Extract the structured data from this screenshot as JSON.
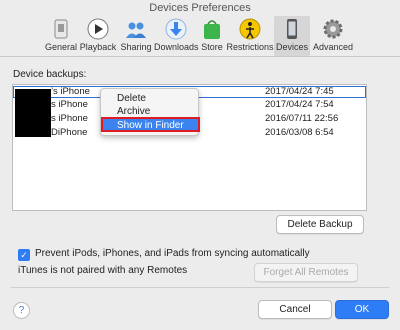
{
  "window": {
    "title": "Devices Preferences"
  },
  "toolbar": {
    "items": [
      {
        "label": "General",
        "icon": "general-icon"
      },
      {
        "label": "Playback",
        "icon": "playback-icon"
      },
      {
        "label": "Sharing",
        "icon": "sharing-icon"
      },
      {
        "label": "Downloads",
        "icon": "downloads-icon"
      },
      {
        "label": "Store",
        "icon": "store-icon"
      },
      {
        "label": "Restrictions",
        "icon": "restrictions-icon"
      },
      {
        "label": "Devices",
        "icon": "devices-icon",
        "active": true
      },
      {
        "label": "Advanced",
        "icon": "advanced-icon"
      }
    ]
  },
  "backups": {
    "label": "Device backups:",
    "rows": [
      {
        "name": "’s iPhone",
        "date": "2017/04/24 7:45",
        "selected": true
      },
      {
        "name": "s iPhone",
        "date": "2017/04/24 7:54"
      },
      {
        "name": "s iPhone",
        "date": "2016/07/11 22:56"
      },
      {
        "name": "DiPhone",
        "date": "2016/03/08 6:54"
      }
    ]
  },
  "context_menu": {
    "items": [
      {
        "label": "Delete"
      },
      {
        "label": "Archive"
      },
      {
        "label": "Show in Finder",
        "highlighted": true
      }
    ]
  },
  "buttons": {
    "delete_backup": "Delete Backup",
    "forget_remotes": "Forget All Remotes",
    "cancel": "Cancel",
    "ok": "OK"
  },
  "options": {
    "prevent_sync_label": "Prevent iPods, iPhones, and iPads from syncing automatically",
    "prevent_sync_checked": true,
    "remotes_status": "iTunes is not paired with any Remotes"
  },
  "help": {
    "symbol": "?"
  },
  "colors": {
    "accent": "#2f7df6",
    "highlight_box": "#e01b24"
  }
}
